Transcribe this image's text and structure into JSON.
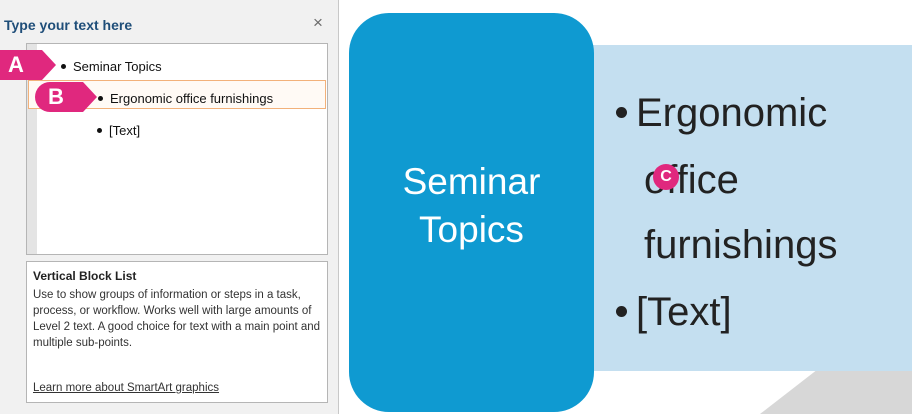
{
  "pane": {
    "title": "Type your text here",
    "close_label": "×",
    "lines": [
      {
        "text": "Seminar Topics",
        "level": 1
      },
      {
        "text": "Ergonomic office furnishings",
        "level": 2,
        "selected": true
      },
      {
        "text": "[Text]",
        "level": 2
      }
    ],
    "description": {
      "title": "Vertical Block List",
      "body": "Use to show groups of information or steps in a task, process, or workflow. Works well with large amounts of Level 2 text. A good choice for text with a main point and multiple sub-points.",
      "link": "Learn more about SmartArt graphics"
    }
  },
  "callouts": {
    "a": "A",
    "b": "B",
    "c": "C"
  },
  "slide": {
    "main_text_line1": "Seminar",
    "main_text_line2": "Topics",
    "bullet1_line1": "Ergonomic",
    "bullet1_line2": "office",
    "bullet1_line3": "furnishings",
    "bullet2": "[Text]"
  },
  "colors": {
    "accent_blue": "#0f9ad1",
    "light_blue": "#c4dff0",
    "callout_pink": "#e0287e",
    "title_blue": "#1f4e79",
    "selection_border": "#f2b17a"
  },
  "icons": {
    "close": "close-icon",
    "bullet": "bullet-dot-icon"
  }
}
